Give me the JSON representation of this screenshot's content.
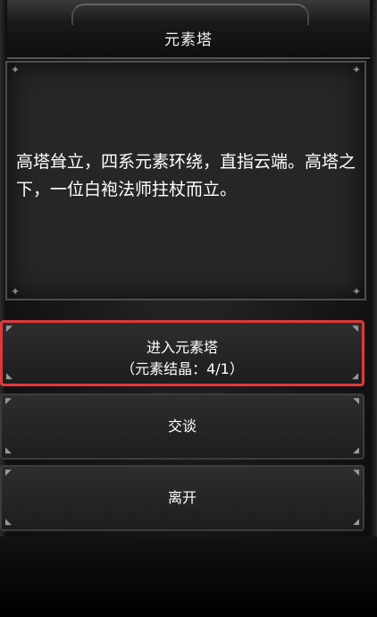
{
  "header": {
    "title": "元素塔"
  },
  "description": {
    "text": "高塔耸立，四系元素环绕，直指云端。高塔之下，一位白袍法师拄杖而立。"
  },
  "options": {
    "enter_label": "进入元素塔",
    "enter_cost": "（元素结晶：4/1）",
    "talk_label": "交谈",
    "leave_label": "离开"
  },
  "colors": {
    "highlight_border": "#e0383b",
    "panel_bg": "#262626",
    "button_bg": "#2a2a2a"
  }
}
